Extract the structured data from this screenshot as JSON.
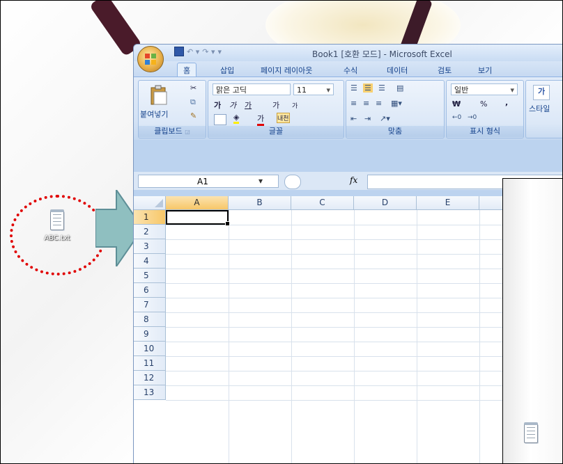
{
  "window": {
    "title": "Book1  [호환 모드] - Microsoft Excel"
  },
  "ribbon_tabs": [
    "홈",
    "삽입",
    "페이지 레이아웃",
    "수식",
    "데이터",
    "검토",
    "보기"
  ],
  "clipboard": {
    "paste_label": "붙여넣기",
    "group_label": "클립보드"
  },
  "font": {
    "family": "맑은 고딕",
    "size": "11",
    "group_label": "글꼴",
    "bold": "가",
    "italic": "가",
    "underline": "가",
    "grow": "가",
    "shrink": "가",
    "color_char": "가",
    "phonetic": "내천"
  },
  "alignment": {
    "group_label": "맞춤"
  },
  "number": {
    "format": "일반",
    "currency": "₩",
    "percent": "%",
    "comma": ",",
    "group_label": "표시 형식"
  },
  "styles": {
    "label": "스타일",
    "icon_char": "가"
  },
  "formula_bar": {
    "name_box": "A1",
    "fx": "fx",
    "value": ""
  },
  "columns": [
    "A",
    "B",
    "C",
    "D",
    "E",
    ""
  ],
  "rows": [
    "1",
    "2",
    "3",
    "4",
    "5",
    "6",
    "7",
    "8",
    "9",
    "10",
    "11",
    "12",
    "13"
  ],
  "selected_cell": "A1",
  "desktop": {
    "icon_label": "ABC.txt"
  },
  "colors": {
    "highlight": "#e00000",
    "arrow": "#8fbfc0"
  }
}
